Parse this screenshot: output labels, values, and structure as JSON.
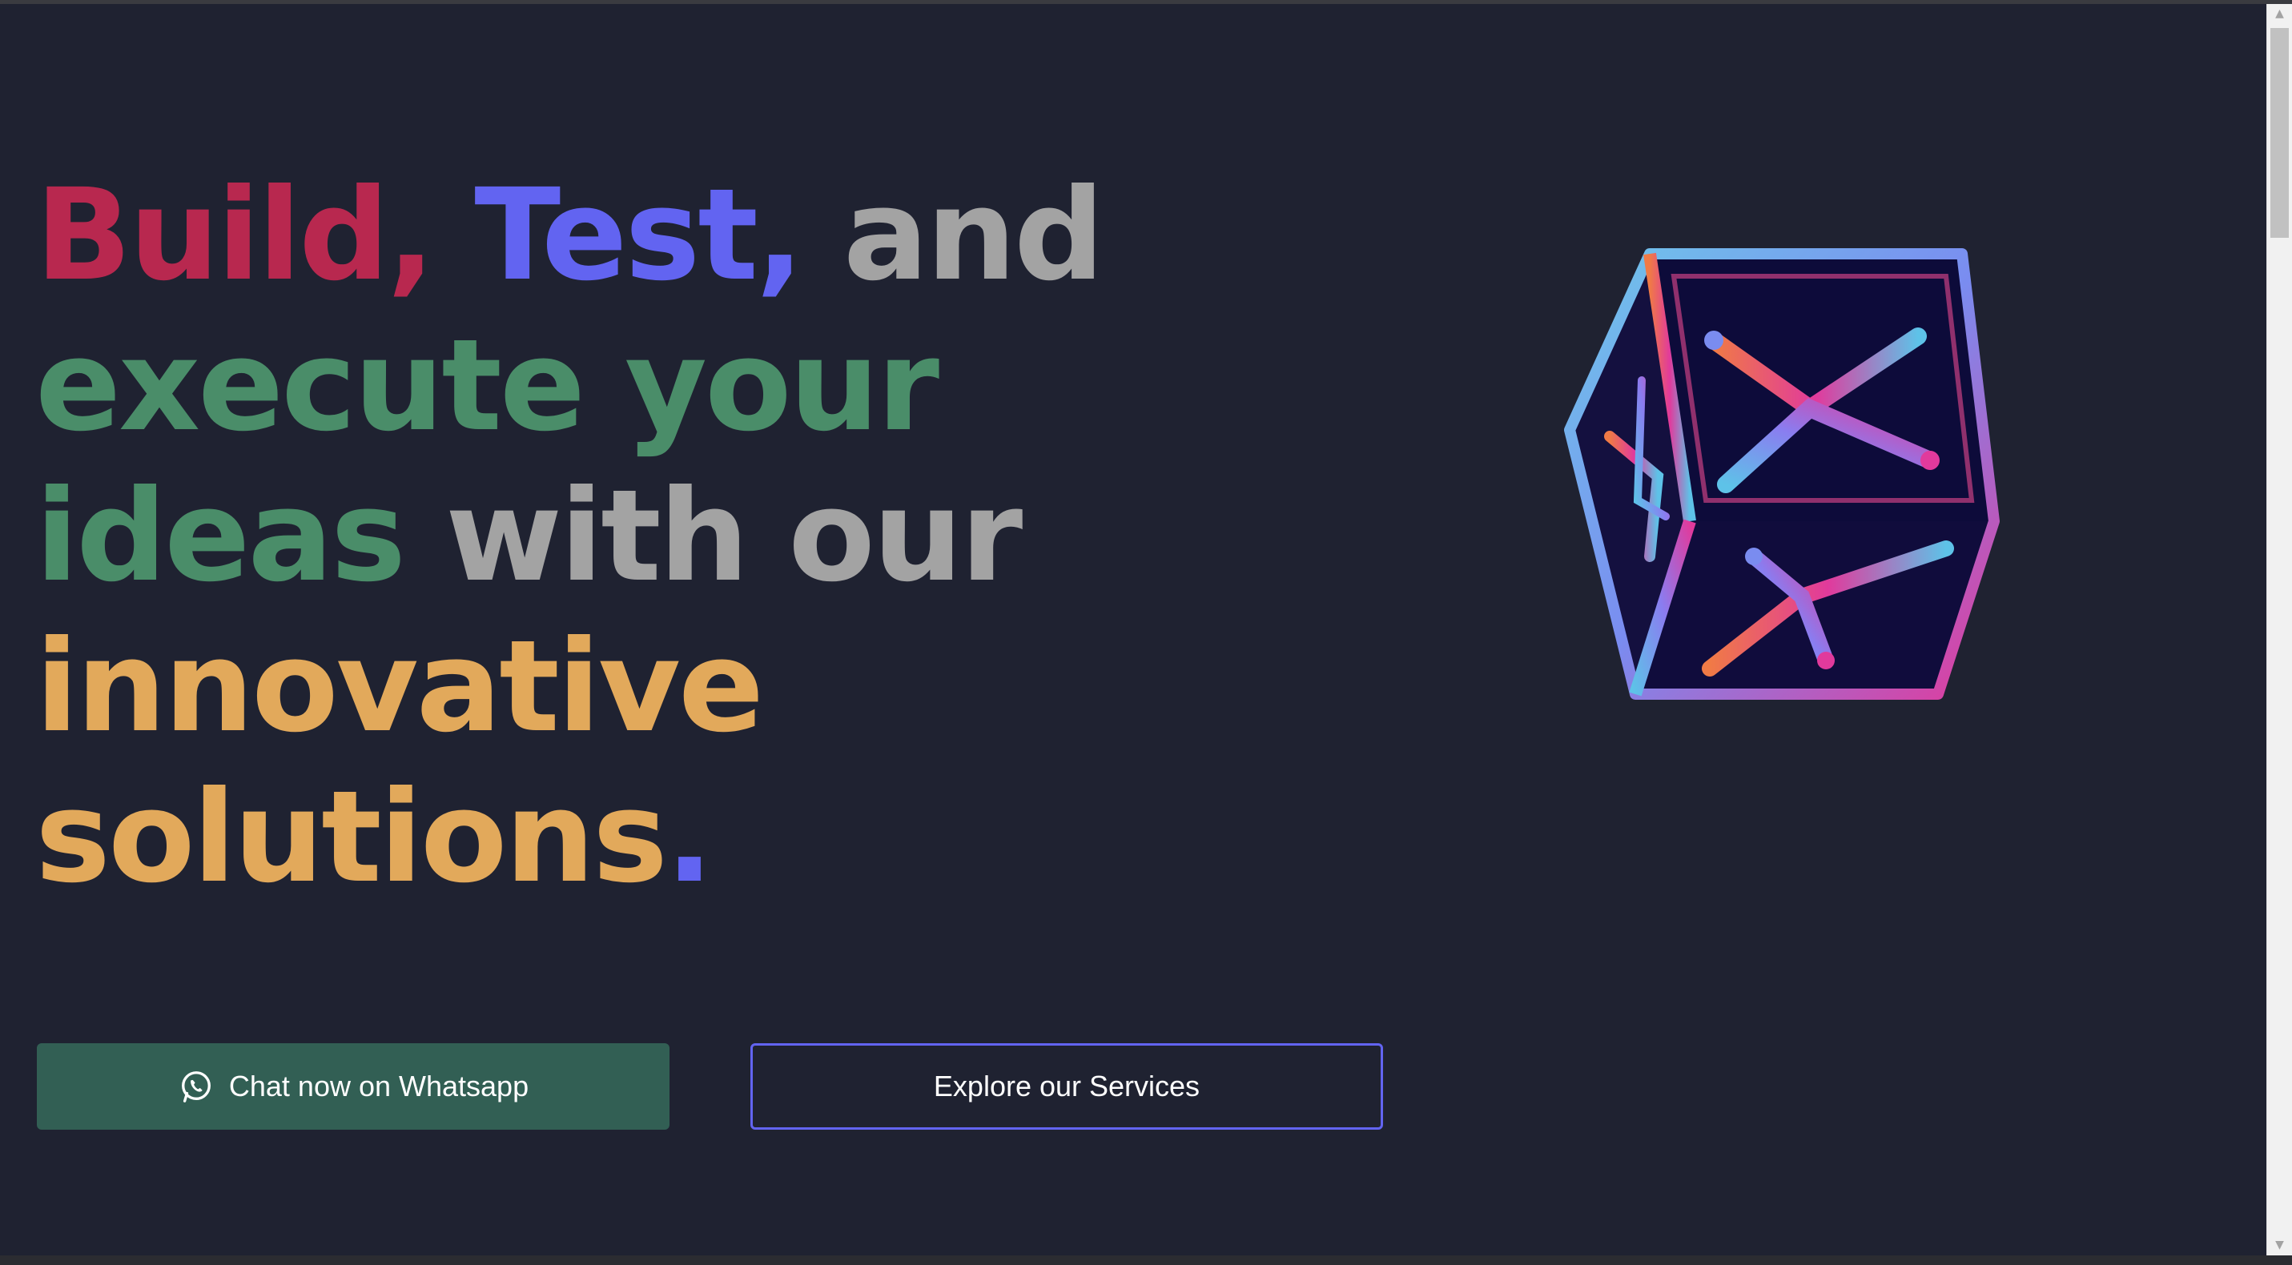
{
  "hero": {
    "headline_words": {
      "build": "Build,",
      "test": "Test,",
      "and": "and",
      "execute_your": "execute your",
      "ideas": "ideas",
      "with_our": "with our",
      "innovative": "innovative",
      "solutions": "solutions",
      "period": "."
    },
    "colors": {
      "build": "#b8284f",
      "test": "#6264f1",
      "neutral": "#a3a3a3",
      "green": "#4a8d69",
      "gold": "#e2a95b",
      "background": "#1f2231"
    }
  },
  "buttons": {
    "whatsapp_label": "Chat now on Whatsapp",
    "whatsapp_icon": "whatsapp-icon",
    "explore_label": "Explore our Services"
  },
  "logo": {
    "icon": "cube-x-logo"
  }
}
